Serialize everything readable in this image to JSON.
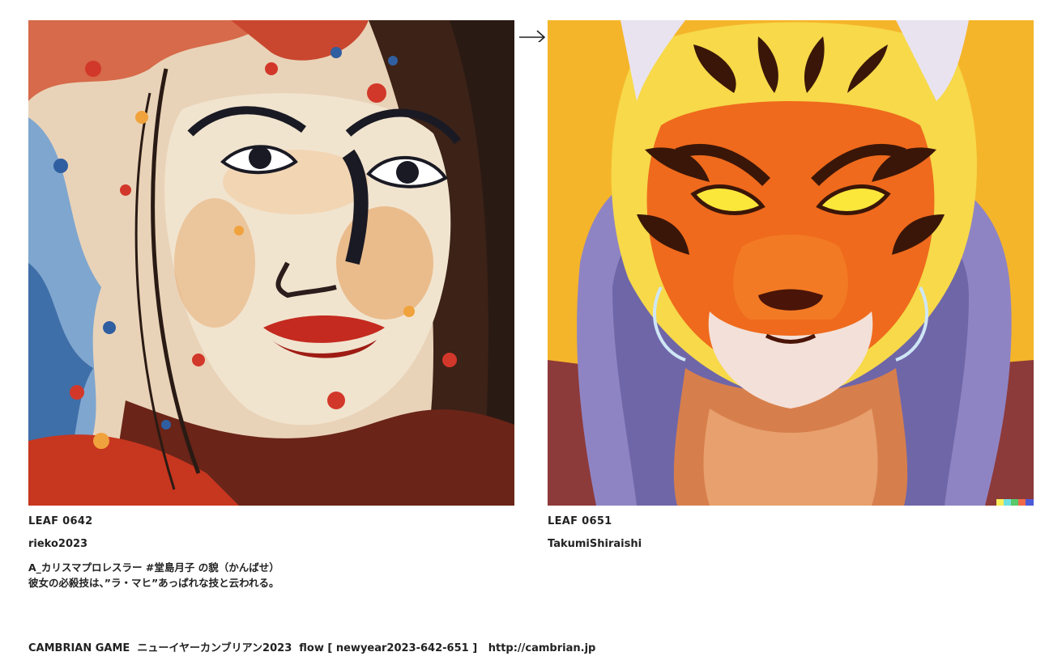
{
  "left": {
    "leaf_id": "LEAF 0642",
    "author": "rieko2023",
    "caption_line1": "A_カリスマプロレスラー #堂島月子 の貌（かんばせ）",
    "caption_line2": "彼女の必殺技は、”ラ・マヒ”あっぱれな技と云われる。",
    "image_alt": "Expressionist painted portrait of a woman with splattered red, blue and orange paint"
  },
  "right": {
    "leaf_id": "LEAF 0651",
    "author": "TakumiShiraishi",
    "image_alt": "Painted portrait of a fierce tiger wearing a purple hoodie on an orange background"
  },
  "arrow_icon": "right-arrow-icon",
  "footer": {
    "text": "CAMBRIAN GAME  ニューイヤーカンブリアン2023  flow [ newyear2023-642-651 ]   ",
    "link": "http://cambrian.jp"
  },
  "colors": {
    "text": "#222222",
    "background": "#ffffff",
    "tiger_bg": "#f5b52a"
  }
}
